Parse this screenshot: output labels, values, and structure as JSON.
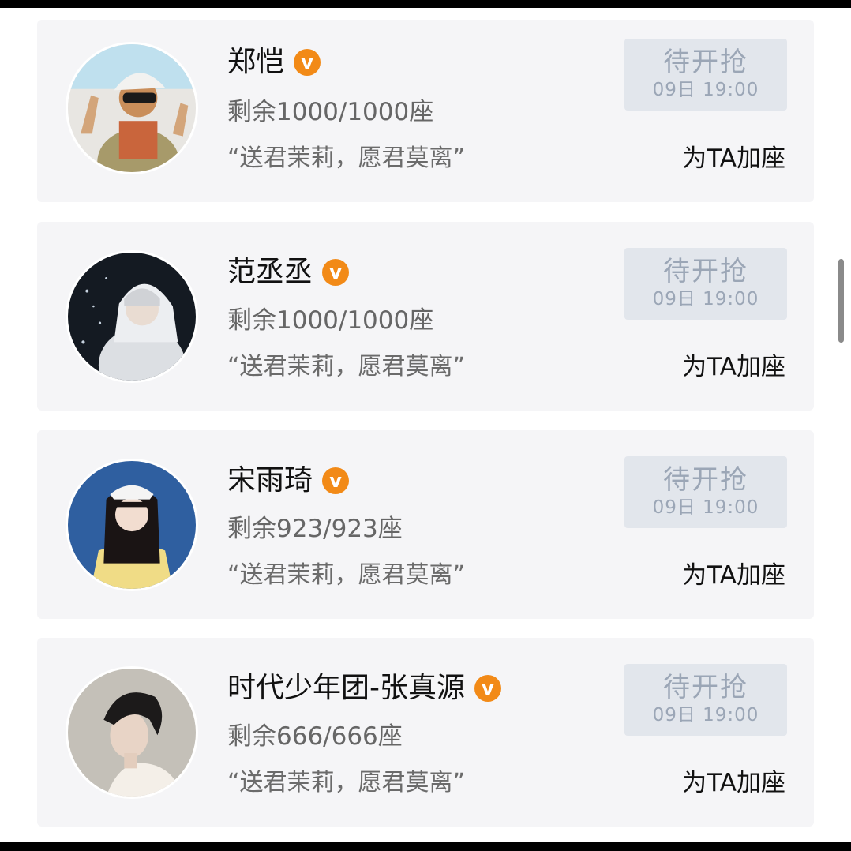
{
  "cards": [
    {
      "name": "郑恺",
      "verified_icon": "v-badge-icon",
      "seats": "剩余1000/1000座",
      "quote": "“送君茉莉，愿君莫离”",
      "button_title": "待开抢",
      "button_time": "09日 19:00",
      "add_seat_label": "为TA加座"
    },
    {
      "name": "范丞丞",
      "verified_icon": "v-badge-icon",
      "seats": "剩余1000/1000座",
      "quote": "“送君茉莉，愿君莫离”",
      "button_title": "待开抢",
      "button_time": "09日 19:00",
      "add_seat_label": "为TA加座"
    },
    {
      "name": "宋雨琦",
      "verified_icon": "v-badge-icon",
      "seats": "剩余923/923座",
      "quote": "“送君茉莉，愿君莫离”",
      "button_title": "待开抢",
      "button_time": "09日 19:00",
      "add_seat_label": "为TA加座"
    },
    {
      "name": "时代少年团-张真源",
      "verified_icon": "v-badge-icon",
      "seats": "剩余666/666座",
      "quote": "“送君茉莉，愿君莫离”",
      "button_title": "待开抢",
      "button_time": "09日 19:00",
      "add_seat_label": "为TA加座"
    }
  ],
  "colors": {
    "card_bg": "#f5f5f7",
    "badge_orange": "#f28a17",
    "button_bg": "#e2e6ec",
    "button_text": "#9ba6b6"
  }
}
